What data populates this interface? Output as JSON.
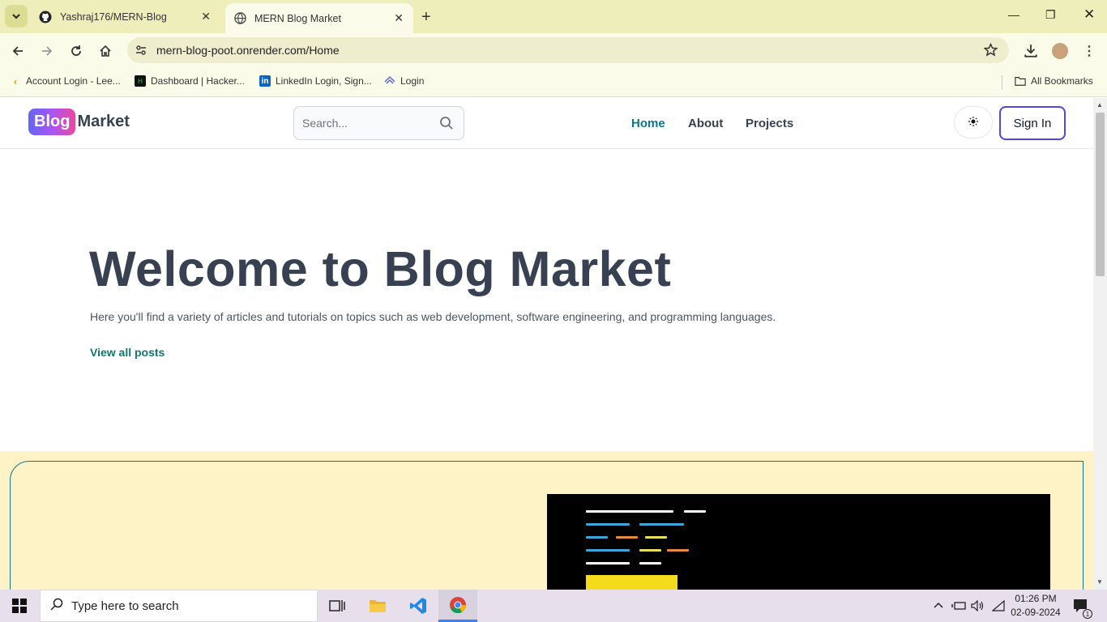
{
  "browser": {
    "tabs": [
      {
        "title": "Yashraj176/MERN-Blog",
        "icon": "github-icon",
        "active": false
      },
      {
        "title": "MERN Blog Market",
        "icon": "globe-icon",
        "active": true
      }
    ],
    "url": "mern-blog-poot.onrender.com/Home",
    "bookmarks": [
      {
        "label": "Account Login - Lee...",
        "icon": "leetcode-icon"
      },
      {
        "label": "Dashboard | Hacker...",
        "icon": "hackerrank-icon"
      },
      {
        "label": "LinkedIn Login, Sign...",
        "icon": "linkedin-icon"
      },
      {
        "label": "Login",
        "icon": "login-icon"
      }
    ],
    "all_bookmarks": "All Bookmarks"
  },
  "site": {
    "logo_badge": "Blog",
    "logo_text": "Market",
    "search_placeholder": "Search...",
    "nav": [
      "Home",
      "About",
      "Projects"
    ],
    "active_nav": "Home",
    "theme_icon": "sun-icon",
    "signin": "Sign In"
  },
  "hero": {
    "title": "Welcome to Blog Market",
    "subtitle": "Here you'll find a variety of articles and tutorials on topics such as web development, software engineering, and programming languages.",
    "link": "View all posts"
  },
  "colors": {
    "accent": "#0e7490",
    "cta_bg": "#fef3c7",
    "heading": "#374151"
  },
  "taskbar": {
    "search_placeholder": "Type here to search",
    "time": "01:26 PM",
    "date": "02-09-2024",
    "notification_count": "1"
  }
}
